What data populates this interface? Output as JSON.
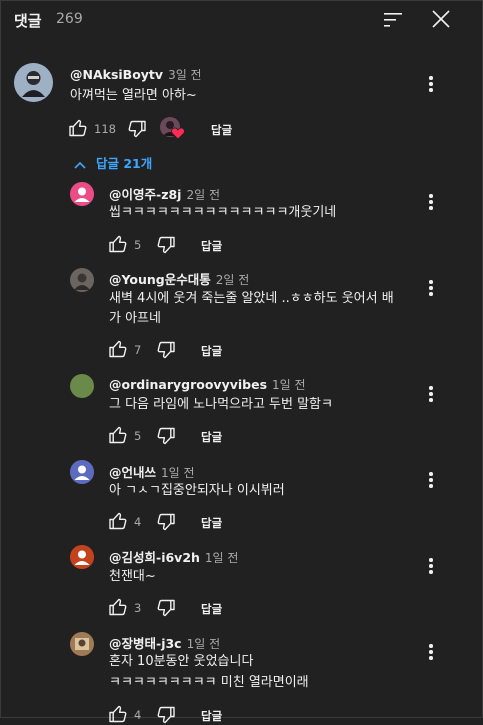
{
  "header": {
    "title": "댓글",
    "count": "269",
    "sort_icon": "sort-icon",
    "close_icon": "close-icon"
  },
  "main_comment": {
    "author": "@NAksiBoytv",
    "time": "3일 전",
    "text": "아껴먹는 열라면 아하~",
    "likes": "118",
    "reply_label": "답글",
    "creator_heart": true
  },
  "replies_toggle": "답글 21개",
  "replies": [
    {
      "author": "@이영주-z8j",
      "time": "2일 전",
      "text": [
        "씹ㅋㅋㅋㅋㅋㅋㅋㅋㅋㅋㅋㅋㅋㅋ개웃기네"
      ],
      "likes": "5",
      "reply_label": "답글",
      "avatar_color": "#e8417f"
    },
    {
      "author": "@Young운수대통",
      "time": "2일 전",
      "text": [
        "새벽 4시에 웃겨 죽는줄 알았네 ..ㅎㅎ하도 웃어서 배",
        "가 아프네"
      ],
      "likes": "7",
      "reply_label": "답글",
      "avatar_color": "#5a5550"
    },
    {
      "author": "@ordinarygroovyvibes",
      "time": "1일 전",
      "text": [
        "그 다음 라임에 노나먹으라고 두번 말함ㅋ"
      ],
      "likes": "5",
      "reply_label": "답글",
      "avatar_color": "#6a8a4a"
    },
    {
      "author": "@언내쓰",
      "time": "1일 전",
      "text": [
        "아 ㄱㅅㄱ집중안되자나 이시뷔러"
      ],
      "likes": "4",
      "reply_label": "답글",
      "avatar_color": "#5c6bc0"
    },
    {
      "author": "@김성희-i6v2h",
      "time": "1일 전",
      "text": [
        "천잰대~"
      ],
      "likes": "3",
      "reply_label": "답글",
      "avatar_color": "#c0401f"
    },
    {
      "author": "@장병태-j3c",
      "time": "1일 전",
      "text": [
        "혼자 10분동안 웃었습니다",
        "ㅋㅋㅋㅋㅋㅋㅋㅋㅋ 미친 열라면이래"
      ],
      "likes": "4",
      "reply_label": "답글",
      "avatar_color": "#8a6a4a"
    }
  ]
}
